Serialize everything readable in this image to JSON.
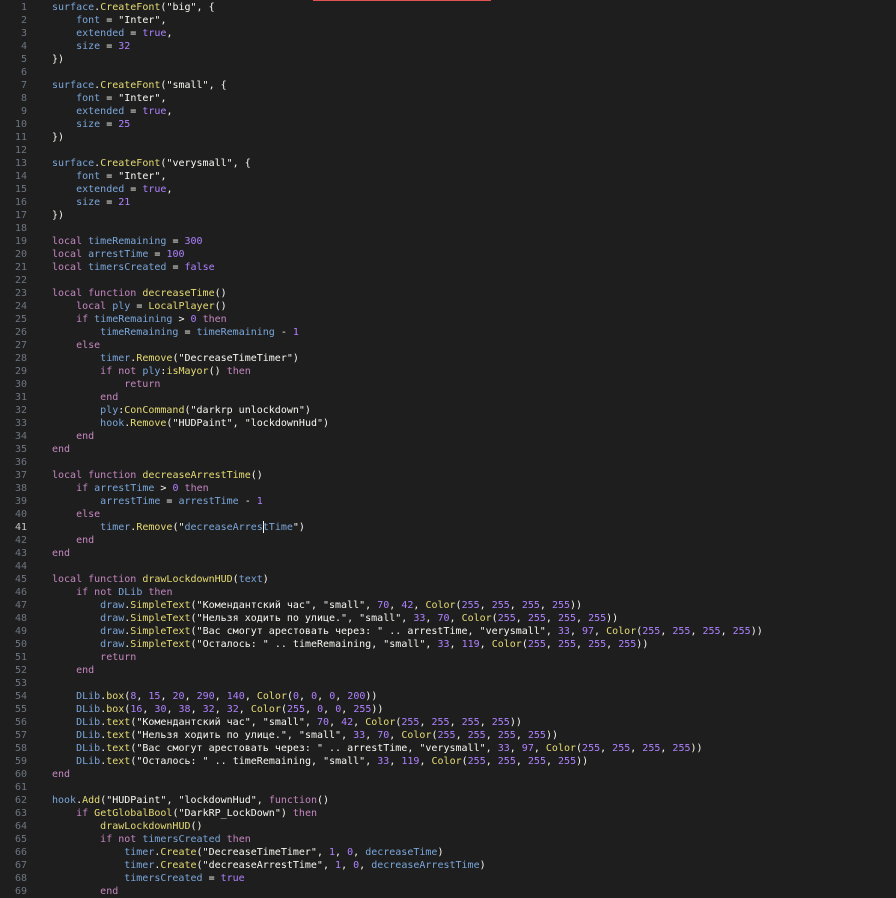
{
  "editor": {
    "active_line": 41,
    "cursor": {
      "line": 41,
      "after_text": "        timer.Remove(\"decreaseArres"
    },
    "colors": {
      "background": "#1e1e1e",
      "gutter_text": "#6e7681",
      "gutter_active": "#c6c6c6",
      "accent": "#e05252"
    },
    "lines": [
      {
        "n": "1",
        "text": "surface.CreateFont(\"big\", {"
      },
      {
        "n": "2",
        "text": "    font = \"Inter\","
      },
      {
        "n": "3",
        "text": "    extended = true,"
      },
      {
        "n": "4",
        "text": "    size = 32"
      },
      {
        "n": "5",
        "text": "})"
      },
      {
        "n": "6",
        "text": ""
      },
      {
        "n": "7",
        "text": "surface.CreateFont(\"small\", {"
      },
      {
        "n": "8",
        "text": "    font = \"Inter\","
      },
      {
        "n": "9",
        "text": "    extended = true,"
      },
      {
        "n": "10",
        "text": "    size = 25"
      },
      {
        "n": "11",
        "text": "})"
      },
      {
        "n": "12",
        "text": ""
      },
      {
        "n": "13",
        "text": "surface.CreateFont(\"verysmall\", {"
      },
      {
        "n": "14",
        "text": "    font = \"Inter\","
      },
      {
        "n": "15",
        "text": "    extended = true,"
      },
      {
        "n": "16",
        "text": "    size = 21"
      },
      {
        "n": "17",
        "text": "})"
      },
      {
        "n": "18",
        "text": ""
      },
      {
        "n": "19",
        "text": "local timeRemaining = 300"
      },
      {
        "n": "20",
        "text": "local arrestTime = 100"
      },
      {
        "n": "21",
        "text": "local timersCreated = false"
      },
      {
        "n": "22",
        "text": ""
      },
      {
        "n": "23",
        "text": "local function decreaseTime()"
      },
      {
        "n": "24",
        "text": "    local ply = LocalPlayer()"
      },
      {
        "n": "25",
        "text": "    if timeRemaining > 0 then"
      },
      {
        "n": "26",
        "text": "        timeRemaining = timeRemaining - 1"
      },
      {
        "n": "27",
        "text": "    else"
      },
      {
        "n": "28",
        "text": "        timer.Remove(\"DecreaseTimeTimer\")"
      },
      {
        "n": "29",
        "text": "        if not ply:isMayor() then"
      },
      {
        "n": "30",
        "text": "            return"
      },
      {
        "n": "31",
        "text": "        end"
      },
      {
        "n": "32",
        "text": "        ply:ConCommand(\"darkrp unlockdown\")"
      },
      {
        "n": "33",
        "text": "        hook.Remove(\"HUDPaint\", \"lockdownHud\")"
      },
      {
        "n": "34",
        "text": "    end"
      },
      {
        "n": "35",
        "text": "end"
      },
      {
        "n": "36",
        "text": ""
      },
      {
        "n": "37",
        "text": "local function decreaseArrestTime()"
      },
      {
        "n": "38",
        "text": "    if arrestTime > 0 then"
      },
      {
        "n": "39",
        "text": "        arrestTime = arrestTime - 1"
      },
      {
        "n": "40",
        "text": "    else"
      },
      {
        "n": "41",
        "text": "        timer.Remove(\"decreaseArrestTime\")"
      },
      {
        "n": "42",
        "text": "    end"
      },
      {
        "n": "43",
        "text": "end"
      },
      {
        "n": "44",
        "text": ""
      },
      {
        "n": "45",
        "text": "local function drawLockdownHUD(text)"
      },
      {
        "n": "46",
        "text": "    if not DLib then"
      },
      {
        "n": "47",
        "text": "        draw.SimpleText(\"Комендантский час\", \"small\", 70, 42, Color(255, 255, 255, 255))"
      },
      {
        "n": "48",
        "text": "        draw.SimpleText(\"Нельзя ходить по улице.\", \"small\", 33, 70, Color(255, 255, 255, 255))"
      },
      {
        "n": "49",
        "text": "        draw.SimpleText(\"Вас смогут арестовать через: \" .. arrestTime, \"verysmall\", 33, 97, Color(255, 255, 255, 255))"
      },
      {
        "n": "50",
        "text": "        draw.SimpleText(\"Осталось: \" .. timeRemaining, \"small\", 33, 119, Color(255, 255, 255, 255))"
      },
      {
        "n": "51",
        "text": "        return"
      },
      {
        "n": "52",
        "text": "    end"
      },
      {
        "n": "53",
        "text": ""
      },
      {
        "n": "54",
        "text": "    DLib.box(8, 15, 20, 290, 140, Color(0, 0, 0, 200))"
      },
      {
        "n": "55",
        "text": "    DLib.box(16, 30, 38, 32, 32, Color(255, 0, 0, 255))"
      },
      {
        "n": "56",
        "text": "    DLib.text(\"Комендантский час\", \"small\", 70, 42, Color(255, 255, 255, 255))"
      },
      {
        "n": "57",
        "text": "    DLib.text(\"Нельзя ходить по улице.\", \"small\", 33, 70, Color(255, 255, 255, 255))"
      },
      {
        "n": "58",
        "text": "    DLib.text(\"Вас смогут арестовать через: \" .. arrestTime, \"verysmall\", 33, 97, Color(255, 255, 255, 255))"
      },
      {
        "n": "59",
        "text": "    DLib.text(\"Осталось: \" .. timeRemaining, \"small\", 33, 119, Color(255, 255, 255, 255))"
      },
      {
        "n": "60",
        "text": "end"
      },
      {
        "n": "61",
        "text": ""
      },
      {
        "n": "62",
        "text": "hook.Add(\"HUDPaint\", \"lockdownHud\", function()"
      },
      {
        "n": "63",
        "text": "    if GetGlobalBool(\"DarkRP_LockDown\") then"
      },
      {
        "n": "64",
        "text": "        drawLockdownHUD()"
      },
      {
        "n": "65",
        "text": "        if not timersCreated then"
      },
      {
        "n": "66",
        "text": "            timer.Create(\"DecreaseTimeTimer\", 1, 0, decreaseTime)"
      },
      {
        "n": "67",
        "text": "            timer.Create(\"decreaseArrestTime\", 1, 0, decreaseArrestTime)"
      },
      {
        "n": "68",
        "text": "            timersCreated = true"
      },
      {
        "n": "69",
        "text": "        end"
      }
    ]
  }
}
